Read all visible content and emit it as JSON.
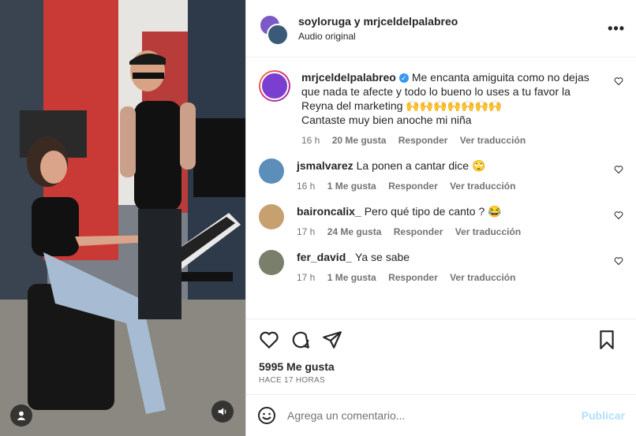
{
  "post": {
    "header_title": "soyloruga y mrjceldelpalabreo",
    "header_sub": "Audio original",
    "more_label": "•••"
  },
  "comments": [
    {
      "user": "mrjceldelpalabreo",
      "verified": true,
      "text": "Me encanta amiguita como no dejas que nada te afecte y todo lo bueno lo uses a tu favor la Reyna del marketing 🙌🙌🙌🙌🙌🙌🙌",
      "text2": "Cantaste muy bien anoche mi niña",
      "time": "16 h",
      "likes": "20 Me gusta",
      "reply": "Responder",
      "translate": "Ver traducción",
      "avatar_color": "#7a3fd1"
    },
    {
      "user": "jsmalvarez",
      "text": "La ponen a cantar dice 🙄",
      "time": "16 h",
      "likes": "1 Me gusta",
      "reply": "Responder",
      "translate": "Ver traducción",
      "avatar_color": "#5b8fb9"
    },
    {
      "user": "baironcalix_",
      "text": "Pero qué tipo de canto ? 😂",
      "time": "17 h",
      "likes": "24 Me gusta",
      "reply": "Responder",
      "translate": "Ver traducción",
      "avatar_color": "#c7a070"
    },
    {
      "user": "fer_david_",
      "text": "Ya se sabe",
      "time": "17 h",
      "likes": "1 Me gusta",
      "reply": "Responder",
      "translate": "Ver traducción",
      "avatar_color": "#7a7f6c"
    }
  ],
  "likes_total": "5995 Me gusta",
  "posted_ago": "HACE 17 HORAS",
  "add_comment": {
    "placeholder": "Agrega un comentario...",
    "publish": "Publicar"
  },
  "icons": {
    "like": "heart-icon",
    "comment": "comment-icon",
    "share": "send-icon",
    "save": "bookmark-icon",
    "emoji": "smiley-icon",
    "user": "user-icon",
    "audio": "speaker-icon"
  }
}
